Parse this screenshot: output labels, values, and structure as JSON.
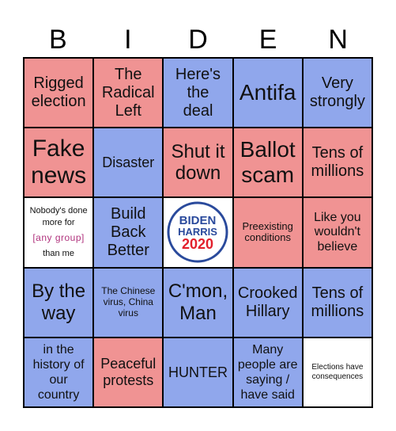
{
  "header": {
    "letters": [
      "B",
      "I",
      "D",
      "E",
      "N"
    ]
  },
  "colors": {
    "red": "#f09393",
    "blue": "#90a7ec",
    "white": "#ffffff",
    "logo_blue": "#2a4a9c",
    "logo_red": "#e2202c",
    "highlight": "#b0337d"
  },
  "cells": [
    {
      "text": "Rigged election",
      "color": "red"
    },
    {
      "text": "The Radical Left",
      "color": "red"
    },
    {
      "text": "Here's the deal",
      "color": "blue"
    },
    {
      "text": "Antifa",
      "color": "blue"
    },
    {
      "text": "Very strongly",
      "color": "blue"
    },
    {
      "text": "Fake news",
      "color": "red"
    },
    {
      "text": "Disaster",
      "color": "blue"
    },
    {
      "text": "Shut it down",
      "color": "red"
    },
    {
      "text": "Ballot scam",
      "color": "red"
    },
    {
      "text": "Tens of millions",
      "color": "red"
    },
    {
      "text_before": "Nobody's done more for",
      "highlight": "[any group]",
      "text_after": "than me",
      "color": "white"
    },
    {
      "text": "Build Back Better",
      "color": "blue"
    },
    {
      "logo": {
        "line1": "BIDEN",
        "line2": "HARRIS",
        "line3": "2020"
      },
      "color": "white"
    },
    {
      "text": "Preexisting conditions",
      "color": "red"
    },
    {
      "text": "Like you wouldn't believe",
      "color": "red"
    },
    {
      "text": "By the way",
      "color": "blue"
    },
    {
      "text": "The Chinese virus, China virus",
      "color": "blue"
    },
    {
      "text": "C'mon, Man",
      "color": "blue"
    },
    {
      "text": "Crooked Hillary",
      "color": "blue"
    },
    {
      "text": "Tens of millions",
      "color": "blue"
    },
    {
      "text": "in the history of our country",
      "color": "blue"
    },
    {
      "text": "Peaceful protests",
      "color": "red"
    },
    {
      "text": "HUNTER",
      "color": "blue"
    },
    {
      "text": "Many people are saying / have said",
      "color": "blue"
    },
    {
      "text": "Elections have consequences",
      "color": "white"
    }
  ]
}
